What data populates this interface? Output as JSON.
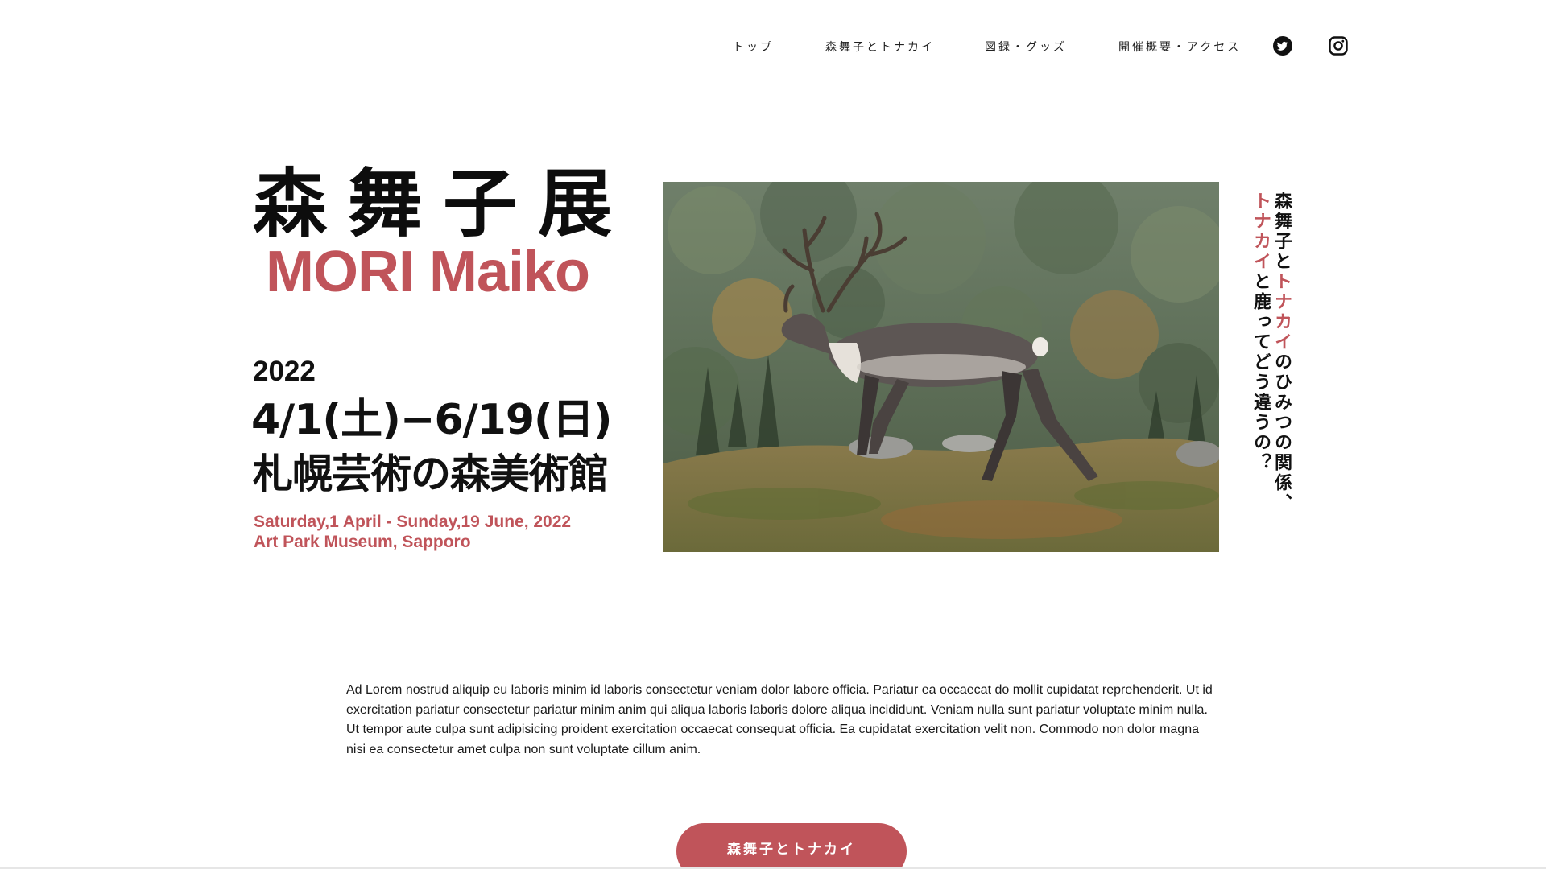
{
  "nav": {
    "items": [
      {
        "label": "トップ"
      },
      {
        "label": "森舞子とトナカイ"
      },
      {
        "label": "図録・グッズ"
      },
      {
        "label": "開催概要・アクセス"
      }
    ],
    "icons": [
      "twitter-icon",
      "instagram-icon"
    ]
  },
  "hero": {
    "title_jp": "森舞子展",
    "title_en": "MORI Maiko",
    "year": "2022",
    "dates": "4/1(土)−6/19(日)",
    "venue_jp": "札幌芸術の森美術館",
    "dates_en": "Saturday,1 April - Sunday,19 June, 2022",
    "venue_en": "Art Park Museum, Sapporo"
  },
  "vertical": {
    "col1_pre": "森舞子と",
    "col1_accent": "トナカイ",
    "col1_post": "のひみつの関係、",
    "col2_accent": "トナカイ",
    "col2_post": "と鹿ってどう違うの？"
  },
  "intro": {
    "p1": "Ad Lorem nostrud aliquip eu laboris minim id laboris consectetur veniam dolor labore officia. Pariatur ea occaecat do mollit cupidatat reprehenderit. Ut id exercitation pariatur consectetur pariatur minim anim qui aliqua laboris laboris dolore aliqua incididunt. Veniam nulla sunt pariatur voluptate minim nulla.",
    "p2": "Ut tempor aute culpa sunt adipisicing proident exercitation occaecat consequat officia. Ea cupidatat exercitation velit non. Commodo non dolor magna nisi ea consectetur amet culpa non sunt voluptate cillum anim."
  },
  "cta": {
    "label": "森舞子とトナカイ"
  },
  "colors": {
    "accent": "#c0545a",
    "text": "#111111",
    "background": "#ffffff"
  }
}
